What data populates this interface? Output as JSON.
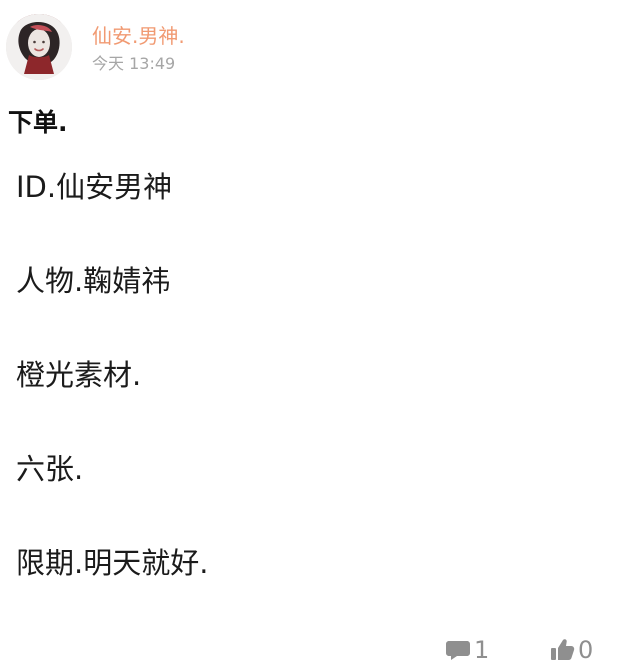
{
  "header": {
    "username": "仙安.男神.",
    "time": "今天 13:49"
  },
  "post": {
    "title": "下单.",
    "lines": [
      "ID.仙安男神",
      "人物.鞠婧祎",
      "橙光素材.",
      "六张.",
      "限期.明天就好."
    ]
  },
  "footer": {
    "comment_count": "1",
    "like_count": "0"
  },
  "icons": {
    "avatar": "avatar",
    "comment": "comment-icon",
    "like": "thumbs-up-icon"
  },
  "colors": {
    "username": "#f19a72",
    "time": "#a6a6a6",
    "text": "#1b1b1b",
    "footer": "#8f8f8f"
  }
}
